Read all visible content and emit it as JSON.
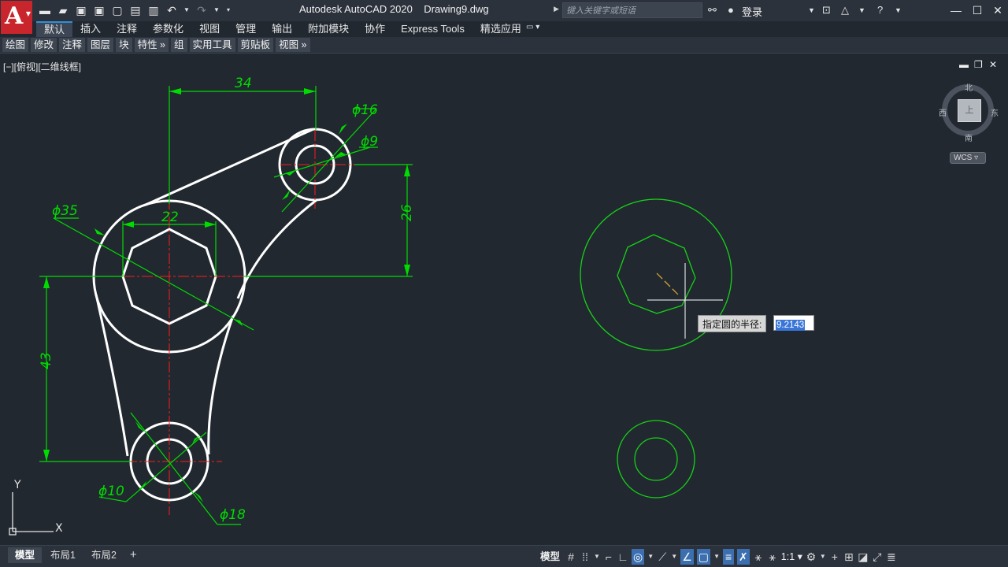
{
  "app": {
    "logo_letter": "A",
    "title": "Autodesk AutoCAD 2020    Drawing9.dwg",
    "search_placeholder": "键入关键字或短语",
    "login_label": "登录"
  },
  "quick_access": [
    {
      "name": "new-file",
      "glyph": "▬"
    },
    {
      "name": "open-file",
      "glyph": "▰"
    },
    {
      "name": "save",
      "glyph": "▣"
    },
    {
      "name": "save-as",
      "glyph": "▣"
    },
    {
      "name": "web-mobile",
      "glyph": "▢"
    },
    {
      "name": "export",
      "glyph": "▤"
    },
    {
      "name": "plot",
      "glyph": "▥"
    },
    {
      "name": "undo",
      "glyph": "↶"
    },
    {
      "name": "redo",
      "glyph": "↷"
    }
  ],
  "ribbon": {
    "tabs": [
      "默认",
      "插入",
      "注释",
      "参数化",
      "视图",
      "管理",
      "输出",
      "附加模块",
      "协作",
      "Express Tools",
      "精选应用"
    ],
    "active_tab": "默认",
    "panels": [
      "绘图",
      "修改",
      "注释",
      "图层",
      "块",
      "特性 »",
      "组",
      "实用工具",
      "剪贴板",
      "视图 »"
    ]
  },
  "viewport": {
    "label": "[−][俯视][二维线框]",
    "compass": {
      "north": "北",
      "south": "南",
      "east": "东",
      "west": "西"
    },
    "cube_face": "上",
    "wcs_label": "WCS ▿",
    "ucs": {
      "x": "X",
      "y": "Y"
    }
  },
  "drawing": {
    "dimensions": {
      "d34": "34",
      "d16": "ϕ16",
      "d9": "ϕ9",
      "d22": "22",
      "d35": "ϕ35",
      "d26": "26",
      "d43": "43",
      "d10": "ϕ10",
      "d18": "ϕ18"
    }
  },
  "dynamic_input": {
    "prompt": "指定圆的半径:",
    "value": "9.2143"
  },
  "status_bar": {
    "layout_tabs": [
      "模型",
      "布局1",
      "布局2"
    ],
    "active_layout": "模型",
    "add_layout": "+",
    "model_button": "模型",
    "scale": "1:1 ▾"
  },
  "colors": {
    "background": "#212830",
    "geometry": "#ffffff",
    "dimension": "#00dc00",
    "centerline": "#ff1a1a",
    "new_geometry": "#17d117",
    "accent": "#2e8fd8",
    "logo": "#c8252c"
  }
}
